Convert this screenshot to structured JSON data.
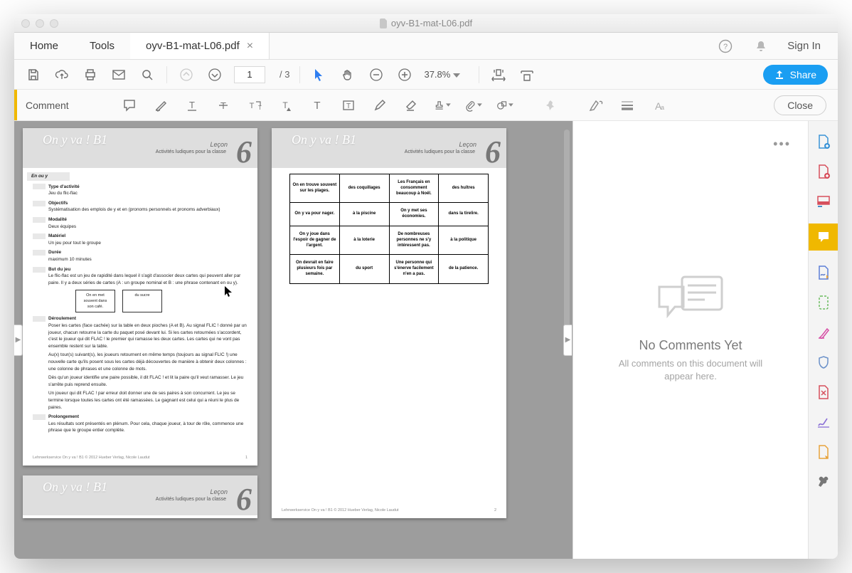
{
  "window": {
    "title": "oyv-B1-mat-L06.pdf"
  },
  "tabs": {
    "home": "Home",
    "tools": "Tools",
    "file": "oyv-B1-mat-L06.pdf",
    "signin": "Sign In"
  },
  "toolbar1": {
    "page_current": "1",
    "page_total": "/ 3",
    "zoom": "37.8%"
  },
  "share": {
    "label": "Share"
  },
  "toolbar2": {
    "label": "Comment",
    "close": "Close"
  },
  "comments": {
    "title": "No Comments Yet",
    "sub": "All comments on this document will appear here."
  },
  "doc_header": {
    "onyva": "On y va ! B1",
    "lecon": "Leçon",
    "big6": "6",
    "subtitle": "Activités ludiques pour la classe"
  },
  "page1": {
    "enouy": "En ou y",
    "s1": "Type d'activité",
    "p1": "Jeu du flic-flac",
    "s2": "Objectifs",
    "p2": "Systématisation des emplois de y et en (pronoms personnels et pronoms adverbiaux)",
    "s3": "Modalité",
    "p3": "Deux équipes",
    "s4": "Matériel",
    "p4": "Un jeu pour tout le groupe",
    "s5": "Durée",
    "p5": "maximum 10 minutes",
    "s6": "But du jeu",
    "p6a": "Le flic-flac est un jeu de rapidité dans lequel il s'agit d'associer deux cartes qui peuvent aller par paire. Il y a deux séries de cartes (A : un groupe nominal et B : une phrase contenant en ou y).",
    "box1": "On en met souvent dans son café.",
    "box2": "du sucre",
    "s7": "Déroulement",
    "p7a": "Poser les cartes (face cachée) sur la table en deux pioches (A et B). Au signal FLIC ! donné par un joueur, chacun retourne la carte du paquet posé devant lui. Si les cartes retournées s'accordent, c'est le joueur qui dit FLAC ! le premier qui ramasse les deux cartes. Les cartes qui ne vont pas ensemble restent sur la table.",
    "p7b": "Au(x) tour(s) suivant(s), les joueurs retournent en même temps (toujours au signal FLIC !) une nouvelle carte qu'ils posent sous les cartes déjà découvertes de manière à obtenir deux colonnes : une colonne de phrases et une colonne de mots.",
    "p7c": "Dès qu'un joueur identifie une paire possible, il dit FLAC ! et lit la paire qu'il veut ramasser. Le jeu s'arrête puis reprend ensuite.",
    "p7d": "Un joueur qui dit FLAC ! par erreur doit donner une de ses paires à son concurrent. Le jeu se termine lorsque toutes les cartes ont été ramassées. Le gagnant est celui qui a réuni le plus de paires.",
    "s8": "Prolongement",
    "p8": "Les résultats sont présentés en plénum. Pour cela, chaque joueur, à tour de rôle, commence une phrase que le groupe entier complète.",
    "footer": "Lehrwerkservice On y va ! B1 © 2012 Hueber Verlag, Nicole Laudut",
    "pn": "1"
  },
  "page2": {
    "grid": [
      [
        "On en trouve souvent sur les plages.",
        "des coquillages",
        "Les Français en consomment beaucoup à Noël.",
        "des huîtres"
      ],
      [
        "On y va pour nager.",
        "à la piscine",
        "On y met ses économies.",
        "dans la tirelire."
      ],
      [
        "On y joue dans l'espoir de gagner de l'argent.",
        "à la loterie",
        "De nombreuses personnes ne s'y intéressent pas.",
        "à la politique"
      ],
      [
        "On devrait en faire plusieurs fois par semaine.",
        "du sport",
        "Une personne qui s'énerve facilement n'en a pas.",
        "de la patience."
      ]
    ],
    "footer": "Lehrwerkservice On y va ! B1 © 2012 Hueber Verlag, Nicole Laudut",
    "pn": "2"
  }
}
